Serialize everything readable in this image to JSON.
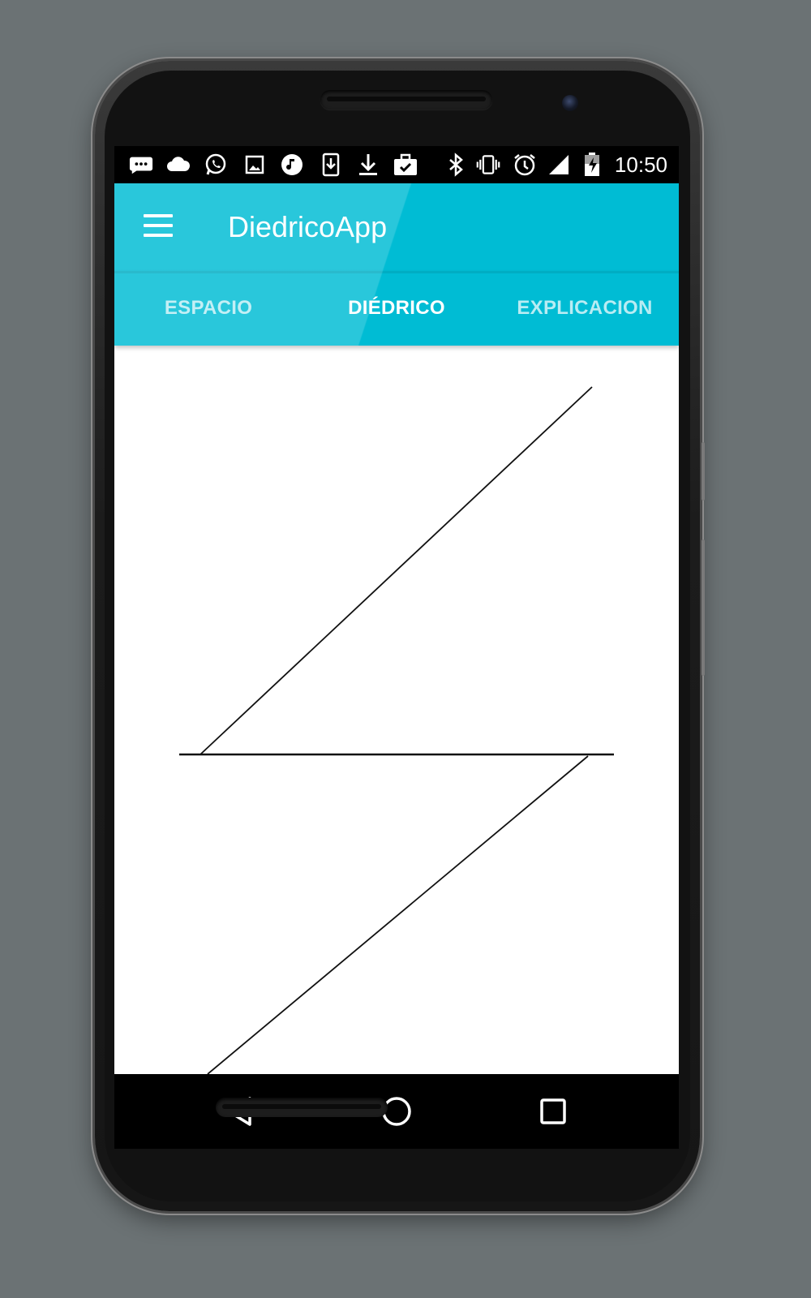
{
  "status_bar": {
    "time": "10:50",
    "icons": [
      "messages-icon",
      "cloud-icon",
      "whatsapp-icon",
      "image-icon",
      "music-icon",
      "download-box-icon",
      "download-icon",
      "briefcase-check-icon",
      "bluetooth-icon",
      "vibrate-icon",
      "alarm-icon",
      "signal-icon",
      "battery-charging-icon"
    ]
  },
  "app_bar": {
    "title": "DiedricoApp",
    "background": "#00bcd4"
  },
  "tabs": [
    {
      "label": "ESPACIO",
      "active": false
    },
    {
      "label": "DIÉDRICO",
      "active": true
    },
    {
      "label": "EXPLICACION",
      "active": false
    }
  ],
  "nav_bar": {
    "buttons": [
      "back-icon",
      "home-icon",
      "recents-icon"
    ]
  }
}
